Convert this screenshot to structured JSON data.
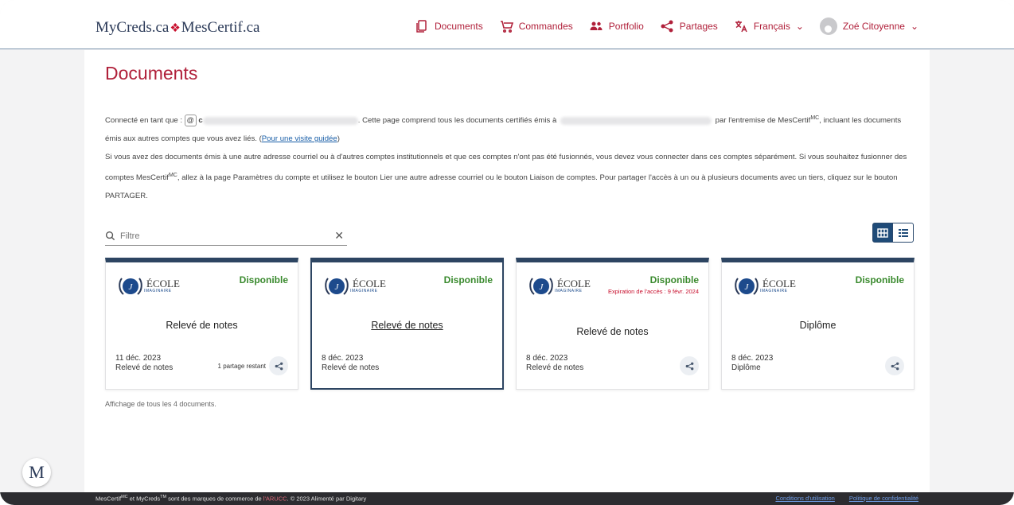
{
  "brand": {
    "left": "MyCreds.ca",
    "right": "MesCertif.ca"
  },
  "nav": {
    "documents": "Documents",
    "orders": "Commandes",
    "portfolio": "Portfolio",
    "shares": "Partages",
    "language": "Français",
    "user": "Zoé Citoyenne"
  },
  "page": {
    "title": "Documents",
    "intro_1a": "Connecté en tant que :",
    "intro_1b": ". Cette page comprend tous les documents certifiés émis à",
    "intro_1c": "par l'entremise de MesCertif",
    "intro_1d": ", incluant les documents émis aux autres comptes que vous avez liés. (",
    "guided_tour": "Pour une visite guidée",
    "intro_1e": ")",
    "intro_2a": "Si vous avez des documents émis à une autre adresse courriel ou à d'autres comptes institutionnels et que ces comptes n'ont pas été fusionnés, vous devez vous connecter dans ces comptes séparément. Si vous souhaitez fusionner des comptes MesCertif",
    "intro_2b": ", allez à la page Paramètres du compte et utilisez le bouton Lier une autre adresse courriel ou le bouton Liaison de comptes. Pour partager l'accès à un ou à plusieurs documents avec un tiers, cliquez sur le bouton PARTAGER.",
    "mc": "MC",
    "email_initial": "c"
  },
  "filter": {
    "placeholder": "Filtre"
  },
  "cards": [
    {
      "school": "ÉCOLE",
      "school_sub": "IMAGINAIRE",
      "status": "Disponible",
      "expiry": "",
      "title": "Relevé de notes",
      "date": "11 déc. 2023",
      "type": "Relevé de notes",
      "shares": "1 partage restant"
    },
    {
      "school": "ÉCOLE",
      "school_sub": "IMAGINAIRE",
      "status": "Disponible",
      "expiry": "",
      "title": "Relevé de notes",
      "date": "8 déc. 2023",
      "type": "Relevé de notes",
      "shares": ""
    },
    {
      "school": "ÉCOLE",
      "school_sub": "IMAGINAIRE",
      "status": "Disponible",
      "expiry": "Expiration de l'accès : 9 févr. 2024",
      "title": "Relevé de notes",
      "date": "8 déc. 2023",
      "type": "Relevé de notes",
      "shares": ""
    },
    {
      "school": "ÉCOLE",
      "school_sub": "IMAGINAIRE",
      "status": "Disponible",
      "expiry": "",
      "title": "Diplôme",
      "date": "8 déc. 2023",
      "type": "Diplôme",
      "shares": ""
    }
  ],
  "showing": "Affichage de tous les 4 documents.",
  "footer": {
    "text_a": "MesCertif",
    "sup_mc": "MC",
    "text_b": " et MyCreds",
    "sup_tm": "TM",
    "text_c": " sont des marques de commerce de ",
    "aracc": "l'ARUCC",
    "text_d": ". © 2023 Alimenté par Digitary",
    "terms": "Conditions d'utilisation",
    "privacy": "Politique de confidentialité"
  },
  "badge": "M",
  "colors": {
    "accent": "#b0203a",
    "navy": "#2d4562",
    "available": "#3a8a2e",
    "expiry": "#c8102e"
  }
}
